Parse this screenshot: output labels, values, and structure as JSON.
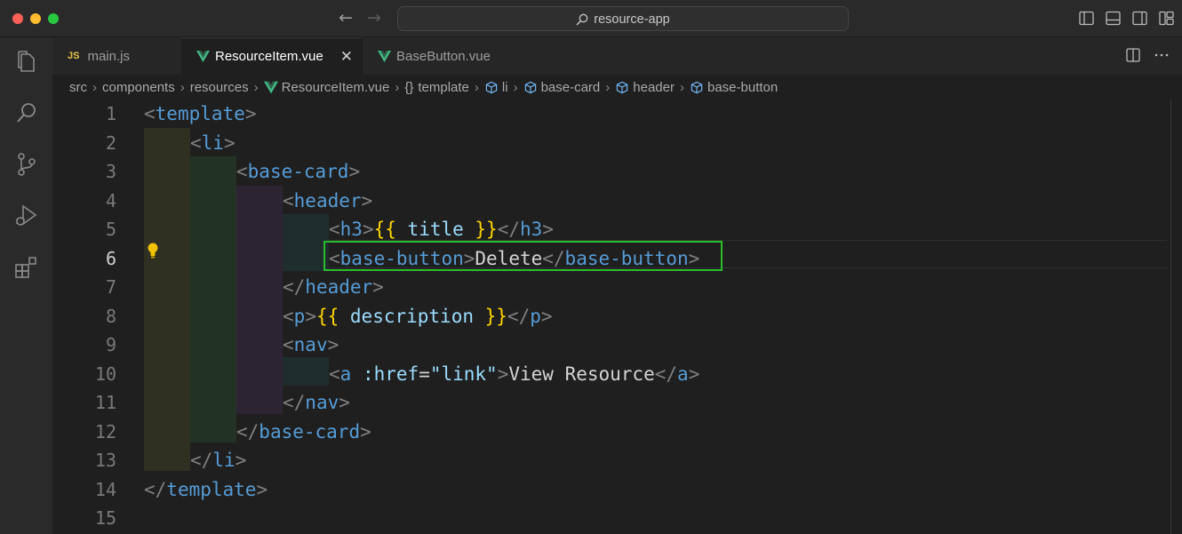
{
  "window": {
    "search_label": "resource-app"
  },
  "tabs": [
    {
      "label": "main.js",
      "badge": "JS"
    },
    {
      "label": "ResourceItem.vue",
      "close": "✕"
    },
    {
      "label": "BaseButton.vue"
    }
  ],
  "breadcrumb": [
    "src",
    "components",
    "resources",
    "ResourceItem.vue",
    "template",
    "li",
    "base-card",
    "header",
    "base-button"
  ],
  "lines": [
    "1",
    "2",
    "3",
    "4",
    "5",
    "6",
    "7",
    "8",
    "9",
    "10",
    "11",
    "12",
    "13",
    "14",
    "15"
  ],
  "active_line": "6",
  "colors": {
    "tag": "#569cd6",
    "mustache": "#ffd700",
    "attribute": "#9cdcfe",
    "highlight_border": "#2bbd2b"
  },
  "code": {
    "l1": {
      "tag": "template"
    },
    "l2": {
      "tag": "li"
    },
    "l3": {
      "tag": "base-card"
    },
    "l4": {
      "tag": "header"
    },
    "l5": {
      "tag": "h3",
      "expr": "title"
    },
    "l6": {
      "tag": "base-button",
      "text": "Delete"
    },
    "l7": {
      "tag": "header"
    },
    "l8": {
      "tag": "p",
      "expr": "description"
    },
    "l9": {
      "tag": "nav"
    },
    "l10": {
      "tag": "a",
      "attr": ":href",
      "value": "\"link\"",
      "text": "View Resource"
    },
    "l11": {
      "tag": "nav"
    },
    "l12": {
      "tag": "base-card"
    },
    "l13": {
      "tag": "li"
    },
    "l14": {
      "tag": "template"
    }
  }
}
